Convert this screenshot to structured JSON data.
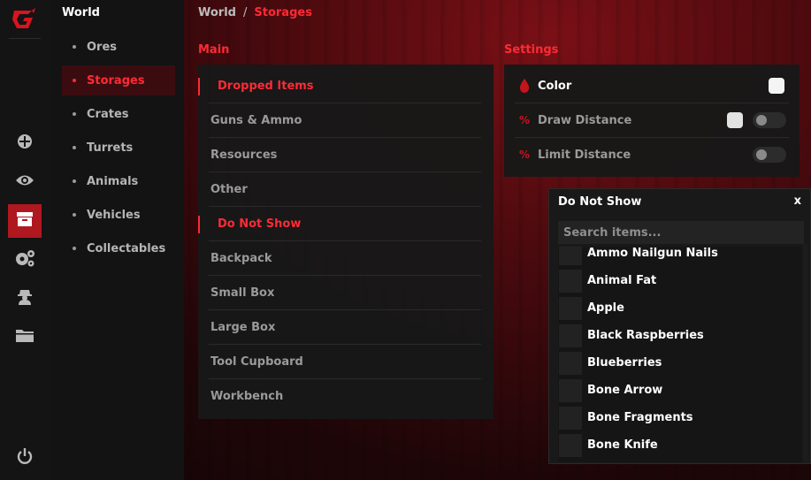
{
  "app": {
    "logo": "G-logo",
    "accent": "#ff2a35",
    "bg_accent": "#b01820"
  },
  "rail": {
    "icons": [
      {
        "name": "crosshair-icon",
        "active": false
      },
      {
        "name": "eye-icon",
        "active": false
      },
      {
        "name": "storage-box-icon",
        "active": true
      },
      {
        "name": "gears-icon",
        "active": false
      },
      {
        "name": "spy-icon",
        "active": false
      },
      {
        "name": "folder-icon",
        "active": false
      },
      {
        "name": "power-icon",
        "active": false
      }
    ]
  },
  "subnav": {
    "title": "World",
    "items": [
      {
        "label": "Ores",
        "active": false
      },
      {
        "label": "Storages",
        "active": true
      },
      {
        "label": "Crates",
        "active": false
      },
      {
        "label": "Turrets",
        "active": false
      },
      {
        "label": "Animals",
        "active": false
      },
      {
        "label": "Vehicles",
        "active": false
      },
      {
        "label": "Collectables",
        "active": false
      }
    ]
  },
  "breadcrumb": {
    "parent": "World",
    "separator": "/",
    "current": "Storages"
  },
  "main": {
    "label": "Main",
    "rows": [
      {
        "label": "Dropped Items",
        "type": "header"
      },
      {
        "label": "Guns & Ammo",
        "type": "item"
      },
      {
        "label": "Resources",
        "type": "item"
      },
      {
        "label": "Other",
        "type": "item"
      },
      {
        "label": "Do Not Show",
        "type": "header"
      },
      {
        "label": "Backpack",
        "type": "item"
      },
      {
        "label": "Small Box",
        "type": "item"
      },
      {
        "label": "Large Box",
        "type": "item"
      },
      {
        "label": "Tool Cupboard",
        "type": "item"
      },
      {
        "label": "Workbench",
        "type": "item"
      }
    ]
  },
  "settings": {
    "label": "Settings",
    "rows": [
      {
        "label": "Color",
        "icon": "drop-icon",
        "color": "#f4f4f4"
      },
      {
        "label": "Draw Distance",
        "icon": "percent-icon",
        "enabled": false
      },
      {
        "label": "Limit Distance",
        "icon": "percent-icon",
        "enabled": false
      }
    ]
  },
  "popup": {
    "title": "Do Not Show",
    "close": "x",
    "search_placeholder": "Search items...",
    "items": [
      "Ammo Nailgun Nails",
      "Animal Fat",
      "Apple",
      "Black Raspberries",
      "Blueberries",
      "Bone Arrow",
      "Bone Fragments",
      "Bone Knife"
    ]
  }
}
